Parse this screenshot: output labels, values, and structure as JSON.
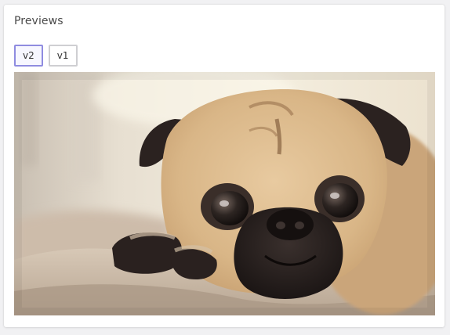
{
  "panel": {
    "title": "Previews"
  },
  "tabs": [
    {
      "label": "v2",
      "selected": true
    },
    {
      "label": "v1",
      "selected": false
    }
  ],
  "preview": {
    "subject": "pug-puppy-photo"
  },
  "colors": {
    "tab_active_border": "#8f8ce0",
    "tab_border": "#cfcfd2",
    "title_text": "#4a4a4a"
  }
}
